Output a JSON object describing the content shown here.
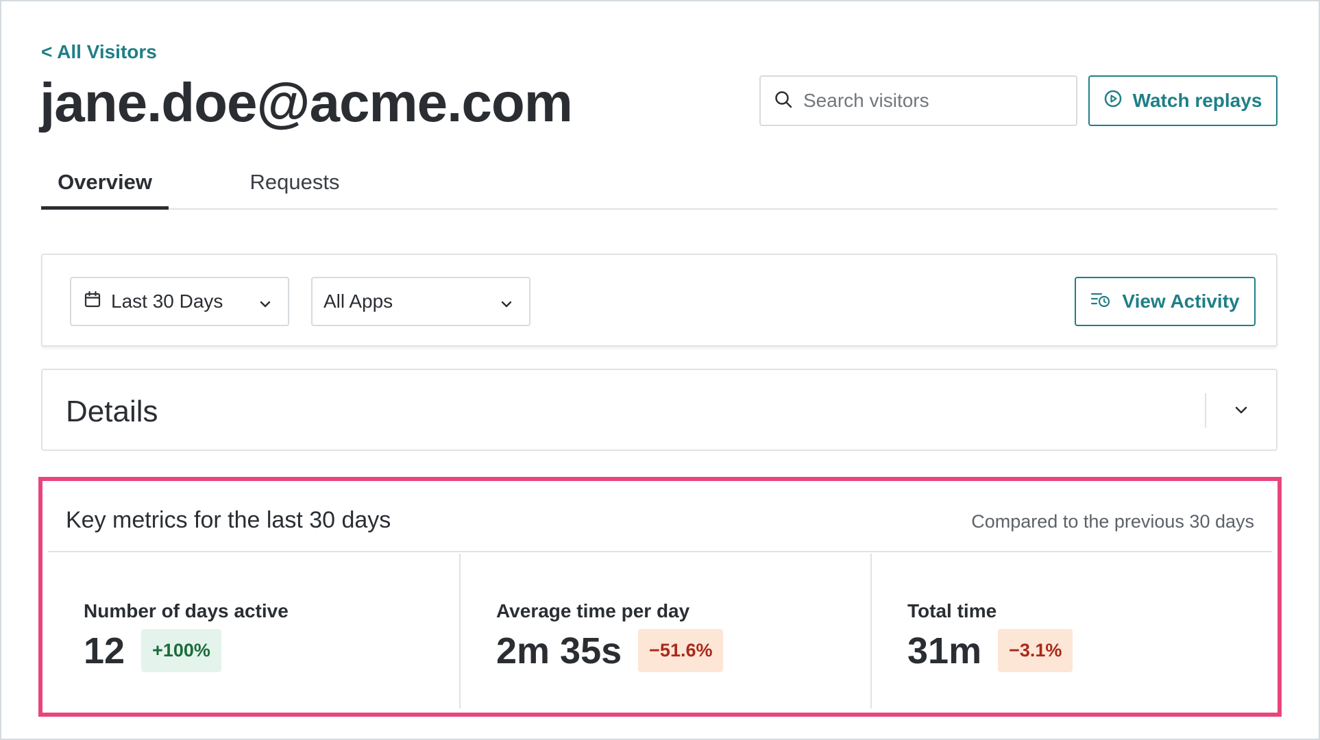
{
  "header": {
    "back_link": "< All Visitors",
    "title": "jane.doe@acme.com",
    "search_placeholder": "Search visitors",
    "watch_replays_label": "Watch replays"
  },
  "tabs": [
    {
      "label": "Overview",
      "active": true
    },
    {
      "label": "Requests",
      "active": false
    }
  ],
  "filters": {
    "date_range": "Last 30 Days",
    "apps": "All Apps",
    "view_activity_label": "View Activity"
  },
  "details": {
    "title": "Details"
  },
  "metrics": {
    "title": "Key metrics for the last 30 days",
    "compare_text": "Compared to the previous 30 days",
    "items": [
      {
        "label": "Number of days active",
        "value": "12",
        "change": "+100%",
        "trend": "up"
      },
      {
        "label": "Average time per day",
        "value": "2m 35s",
        "change": "−51.6%",
        "trend": "down"
      },
      {
        "label": "Total time",
        "value": "31m",
        "change": "−3.1%",
        "trend": "down"
      }
    ]
  },
  "colors": {
    "accent": "#1f7f86",
    "highlight": "#e8457f",
    "positive_bg": "#e4f4ec",
    "negative_bg": "#fde6d6"
  }
}
